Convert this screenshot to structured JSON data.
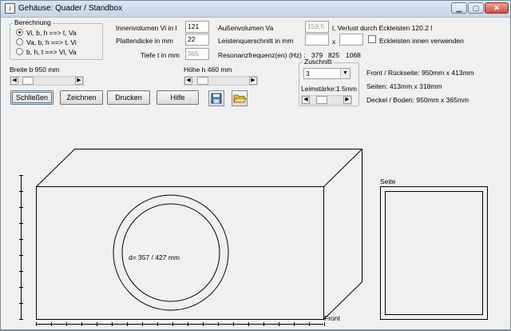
{
  "window": {
    "title": "Gehäuse: Quader / Standbox",
    "app_icon": "speaker-app-icon",
    "min_symbol": "▁",
    "max_symbol": "▢",
    "close_symbol": "✕"
  },
  "berechnung": {
    "title": "Berechnung",
    "options": [
      {
        "label": "Vi, b, h ==>  t, Va",
        "selected": true
      },
      {
        "label": "Va, b, h ==> t, Vi",
        "selected": false
      },
      {
        "label": "b, h, t ==> Vi, Va",
        "selected": false
      }
    ]
  },
  "inputs": {
    "innenvolumen_label": "Innenvolumen Vi in l",
    "innenvolumen_value": "121",
    "plattendicke_label": "Plattendicke in mm",
    "plattendicke_value": "22",
    "tiefe_label": "Tiefe t in mm",
    "tiefe_value": "365",
    "aussenvolumen_label": "Außenvolumen Va",
    "aussenvolumen_value": "159,5",
    "verlust_text": "l, Verlust durch Eckleisten 120.2 l",
    "leistenquerschnitt_label": "Leistenquerschnitt in mm",
    "leiste_a_value": "",
    "times_symbol": "x",
    "leiste_b_value": "",
    "eckleisten_label": "Eckleisten innen verwenden",
    "eckleisten_checked": false,
    "resonanz_label": "Resonanzfrequenz(en) (Hz) :",
    "resonanz_values": [
      "379",
      "825",
      "1068"
    ]
  },
  "sliders": {
    "breite_label": "Breite b 950 mm",
    "breite_level": 0.08,
    "hoehe_label": "Höhe h 460 mm",
    "hoehe_level": 0.1
  },
  "zuschnitt": {
    "title": "Zuschnitt",
    "combo_value": "3",
    "leimstaerke_label": "Leimstärke:1.5mm",
    "leim_level": 0.3,
    "front": "Front / Rückseite: 950mm x 413mm",
    "seiten": "Seiten: 413mm x 318mm",
    "deckel": "Deckel / Boden: 950mm x 365mm"
  },
  "buttons": {
    "schliessen": "Schließen",
    "zeichnen": "Zeichnen",
    "drucken": "Drucken",
    "hilfe": "Hilfe",
    "save_icon": "floppy-disk-icon",
    "open_icon": "open-folder-icon"
  },
  "drawing": {
    "diameter_label": "d= 357 / 427 mm",
    "front_label": "Front",
    "seite_label": "Seite"
  },
  "colors": {
    "window_bg": "#f0f0f0",
    "desktop": "#6f8fa8",
    "line": "#000000"
  }
}
